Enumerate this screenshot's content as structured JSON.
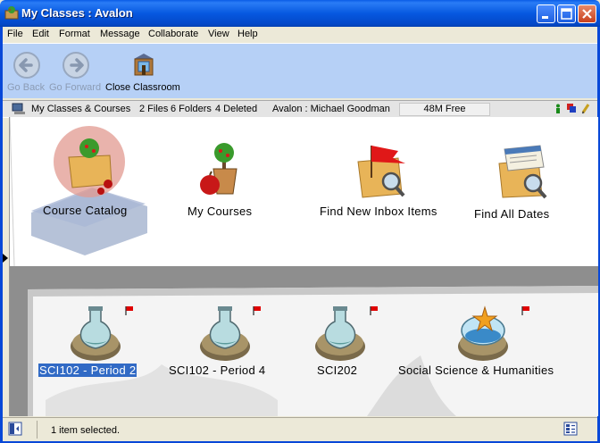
{
  "window": {
    "title": "My Classes : Avalon"
  },
  "menu": [
    "File",
    "Edit",
    "Format",
    "Message",
    "Collaborate",
    "View",
    "Help"
  ],
  "toolbar": {
    "back_label": "Go Back",
    "forward_label": "Go Forward",
    "close_label": "Close Classroom"
  },
  "infobar": {
    "location": "My Classes & Courses",
    "files": "2 Files",
    "folders": "6 Folders",
    "deleted": "4 Deleted",
    "user": "Avalon : Michael Goodman",
    "free": "48M Free"
  },
  "top_items": [
    {
      "label": "Course Catalog",
      "icon": "course-catalog-icon"
    },
    {
      "label": "My Courses",
      "icon": "my-courses-icon"
    },
    {
      "label": "Find New Inbox Items",
      "icon": "find-inbox-icon"
    },
    {
      "label": "Find All Dates",
      "icon": "find-dates-icon"
    }
  ],
  "classes": [
    {
      "label": "SCI102 - Period 2",
      "icon": "flask-icon",
      "selected": true
    },
    {
      "label": "SCI102 - Period 4",
      "icon": "flask-icon",
      "selected": false
    },
    {
      "label": "SCI202",
      "icon": "flask-icon",
      "selected": false
    },
    {
      "label": "Social Science & Humanities",
      "icon": "starfish-bowl-icon",
      "selected": false
    }
  ],
  "statusbar": {
    "text": "1 item selected."
  },
  "colors": {
    "titlebar": "#0658e0",
    "toolbar": "#b6d0f6",
    "selection": "#316ac5",
    "flag": "#e00000"
  }
}
